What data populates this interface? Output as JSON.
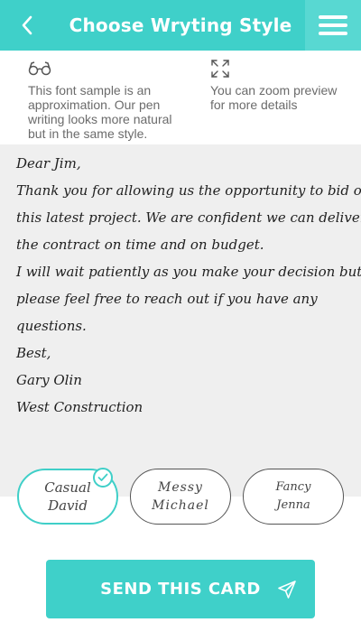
{
  "header": {
    "title": "Choose Wryting Style",
    "back_icon": "chevron-left-icon",
    "menu_icon": "hamburger-menu-icon",
    "accent_color": "#3fd0c9"
  },
  "info": {
    "left": {
      "icon": "glasses-icon",
      "text": "This font sample is an approximation. Our pen writing looks more natural but in the same style."
    },
    "right": {
      "icon": "expand-icon",
      "text": "You can zoom preview for more details"
    }
  },
  "letter": {
    "lines": [
      "Dear Jim,",
      "Thank you for allowing us the opportunity to bid on",
      "this latest project.  We are confident we can deliver",
      "the contract on time and on budget.",
      "I will wait patiently as you make your decision but",
      "please feel free to reach out if you have any",
      "questions.",
      "Best,",
      "Gary Olin",
      "West Construction"
    ]
  },
  "styles": [
    {
      "line1": "Casual",
      "line2": "David",
      "selected": true
    },
    {
      "line1": "Messy",
      "line2": "Michael",
      "selected": false
    },
    {
      "line1": "Fancy",
      "line2": "Jenna",
      "selected": false
    }
  ],
  "send": {
    "label": "SEND THIS CARD",
    "icon": "paper-plane-icon"
  }
}
